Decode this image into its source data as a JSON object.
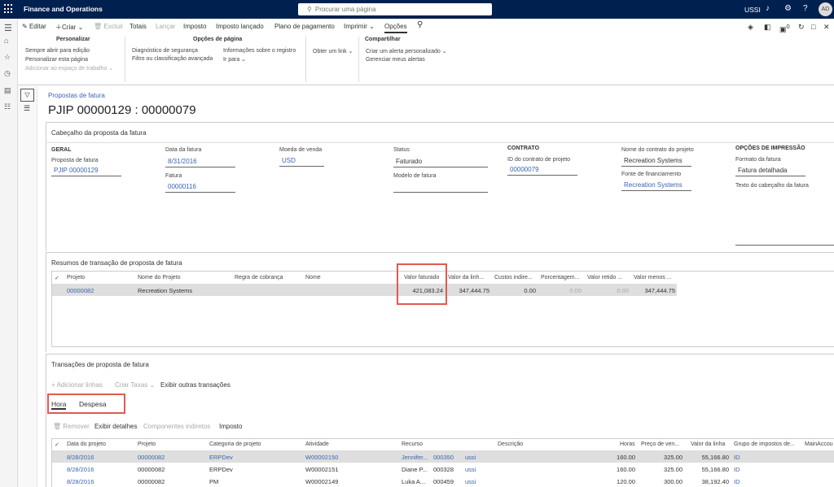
{
  "topbar": {
    "app_title": "Finance and Operations",
    "search_placeholder": "Procurar uma página",
    "company": "USSI",
    "notification_badge": "0",
    "avatar_initials": "AD"
  },
  "actions": {
    "edit": "Editar",
    "new": "Criar",
    "delete": "Excluir",
    "totals": "Totais",
    "post": "Lançar",
    "tax": "Imposto",
    "tax_posted": "Imposto lançado",
    "payment_plan": "Plano de pagamento",
    "print": "Imprimir",
    "options": "Opções"
  },
  "options_pane": {
    "personalize": {
      "header": "Personalizar",
      "items": [
        "Sempre abrir para edição",
        "Personalizar esta página",
        "Adicionar ao espaço de trabalho"
      ]
    },
    "page_options": {
      "header": "Opções de página",
      "items": [
        "Diagnóstico de segurança",
        "Filtro ou classificação avançada",
        "Informações sobre o registro",
        "Ir para"
      ]
    },
    "link": {
      "item": "Obter um link"
    },
    "share": {
      "header": "Compartilhar",
      "items": [
        "Criar um alerta personalizado",
        "Gerenciar meus alertas"
      ]
    }
  },
  "page": {
    "breadcrumb": "Propostas de fatura",
    "title": "PJIP  00000129 : 00000079"
  },
  "header_section": {
    "title": "Cabeçalho da proposta da fatura",
    "geral": "GERAL",
    "proposal_label": "Proposta de fatura",
    "proposal_value": "PJIP  00000129",
    "invoice_date_label": "Data da fatura",
    "invoice_date_value": "8/31/2016",
    "invoice_label": "Fatura",
    "invoice_value": "00000116",
    "currency_label": "Moeda de venda",
    "currency_value": "USD",
    "status_label": "Status",
    "status_value": "Faturado",
    "template_label": "Modelo de fatura",
    "template_value": "",
    "contract_header": "CONTRATO",
    "contract_id_label": "ID do contrato de projeto",
    "contract_id_value": "00000079",
    "contract_name_label": "Nome do contrato do projeto",
    "contract_name_value": "Recreation Systems",
    "funding_label": "Fonte de financiamento",
    "funding_value": "Recreation Systems",
    "print_header": "OPÇÕES DE IMPRESSÃO",
    "format_label": "Formato da fatura",
    "format_value": "Fatura detalhada",
    "header_text_label": "Texto do cabeçalho da fatura"
  },
  "summary_section": {
    "title": "Resumos de transação de proposta de fatura",
    "columns": [
      "Projeto",
      "Nome do Projeto",
      "Regra de cobrança",
      "Nome",
      "Valor faturado",
      "Valor da linh...",
      "Custos indire...",
      "Porcentagem...",
      "Valor retido ...",
      "Valor menos ..."
    ],
    "row": [
      "00000082",
      "Recreation Systems",
      "",
      "",
      "421,083.24",
      "347,444.75",
      "0.00",
      "0.00",
      "0.00",
      "347,444.75"
    ]
  },
  "transactions_section": {
    "title": "Transações de proposta de fatura",
    "toolbar": [
      "Adicionar linhas",
      "Criar Taxas",
      "Exibir outras transações"
    ],
    "tabs": [
      "Hora",
      "Despesa"
    ],
    "subtoolbar": [
      "Remover",
      "Exibir detalhes",
      "Componentes indiretos",
      "Imposto"
    ],
    "columns": [
      "Data do projeto",
      "Projeto",
      "Categoria de projeto",
      "Atividade",
      "Recurso",
      "Descrição",
      "Horas",
      "Preço de ven...",
      "Valor da linha",
      "Grupo de impostos de...",
      "MainAccou"
    ],
    "rows": [
      [
        "8/28/2016",
        "00000082",
        "ERPDev",
        "W00002150",
        "Jennifer...",
        "000350",
        "ussi",
        "",
        "160.00",
        "325.00",
        "55,166.80",
        "ID"
      ],
      [
        "8/28/2016",
        "00000082",
        "ERPDev",
        "W00002151",
        "Diane P...",
        "000328",
        "ussi",
        "",
        "160.00",
        "325.00",
        "55,166.80",
        "ID"
      ],
      [
        "8/28/2016",
        "00000082",
        "PM",
        "W00002149",
        "Luka A...",
        "000459",
        "ussi",
        "",
        "120.00",
        "300.00",
        "38,192.40",
        "ID"
      ]
    ]
  }
}
